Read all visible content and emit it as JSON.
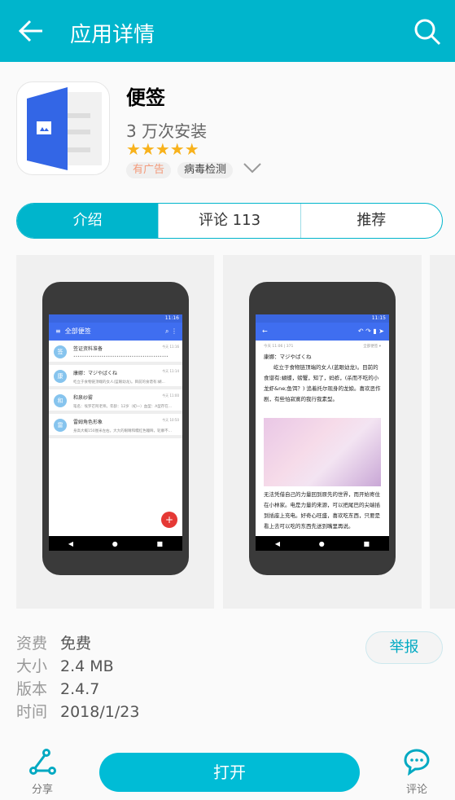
{
  "header": {
    "title": "应用详情",
    "back_icon": "arrow-left-icon",
    "search_icon": "search-icon"
  },
  "app": {
    "name": "便签",
    "installs": "3 万次安装",
    "stars": "★★★★★",
    "rating": 5,
    "tags": [
      "有广告",
      "病毒检测"
    ]
  },
  "tabs": [
    {
      "label": "介绍"
    },
    {
      "label": "评论  113"
    },
    {
      "label": "推荐"
    }
  ],
  "screens": {
    "s1": {
      "time": "11:16",
      "title": "全部便签",
      "notes": [
        {
          "av": "签",
          "title": "签证资料准备",
          "snippet": "••••••••••••••••••••••••••••••••••••••••••••",
          "time": "今天 11:16"
        },
        {
          "av": "康",
          "title": "康娜：マジやばくね",
          "snippet": "屹立于食物链顶端的女人(蓝眼幼龙)。目前的食谱有:蝴...",
          "time": "今天 11:14"
        },
        {
          "av": "和",
          "title": "和泉纱雾",
          "snippet": "笔名：埃罗芒阿老师。年龄：12岁（初一）血型：A型存在...",
          "time": "今天 11:00"
        },
        {
          "av": "雷",
          "title": "雷姆角色形象",
          "snippet": "身高大概150厘米左右。大大的眼睛和糯红色瞳眸，轮廓不...",
          "time": "今天 10:50"
        }
      ],
      "fab": "+"
    },
    "s2": {
      "time": "11:15",
      "meta": "今天 11:06 | 371",
      "folder": "全部便签 ▾",
      "heading": "康娜：マジやばくね",
      "p1": "屹立于食物链顶端的女人(蓝眼幼龙)。目前的食谱有:蝴蝶，螃蟹，知了，蚂蚱，(杀而不吃的小龙虾&ne;鱼饵？) 追着托尔现身的龙娘。喜欢恶作剧，有些怕寂寞的我行我素型。",
      "p2": "无法凭借自己的力量回到原先的世界，而开始寄住在小林家。电是力量的来源，可以把尾巴的尖端插到插座上充电。好奇心旺盛，喜欢吃东西，只要是看上去可以吃的东西先送到嘴里再说。"
    }
  },
  "details": [
    {
      "k": "资费",
      "v": "免费"
    },
    {
      "k": "大小",
      "v": "2.4 MB"
    },
    {
      "k": "版本",
      "v": "2.4.7"
    },
    {
      "k": "时间",
      "v": "2018/1/23"
    }
  ],
  "report_label": "举报",
  "bottom": {
    "share": "分享",
    "open": "打开",
    "comment": "评论"
  },
  "colors": {
    "accent": "#00b5cc",
    "star": "#f8b21c",
    "app_blue": "#3366e6"
  }
}
